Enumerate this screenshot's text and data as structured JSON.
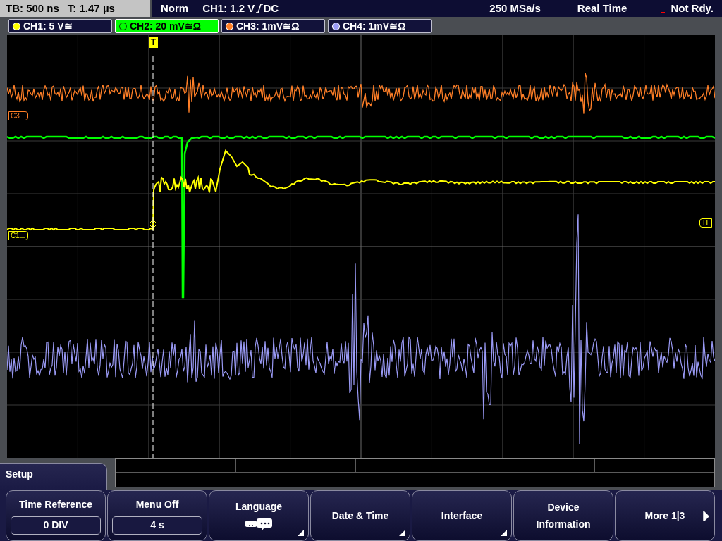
{
  "status_bar": {
    "timebase": "TB: 500 ns",
    "trigger_time": "T: 1.47 µs",
    "trigger_mode": "Norm",
    "trigger_level": "CH1: 1.2 V",
    "trigger_coupling": "DC",
    "sample_rate": "250 MSa/s",
    "acquisition": "Real Time",
    "status": "Not Rdy."
  },
  "channels": [
    {
      "label": "CH1: 5 V≅",
      "color": "#ffff00",
      "selected": false
    },
    {
      "label": "CH2: 20 mV≅Ω",
      "color": "#00ff00",
      "selected": true
    },
    {
      "label": "CH3: 1mV≅Ω",
      "color": "#ff7f27",
      "selected": false
    },
    {
      "label": "CH4: 1mV≅Ω",
      "color": "#9a9af5",
      "selected": false
    }
  ],
  "plot": {
    "trigger_marker": "T",
    "markers": [
      {
        "label": "C3⊥",
        "color": "#ff7f27",
        "kind": "channel"
      },
      {
        "label": "C1⊥",
        "color": "#ffff00",
        "kind": "channel"
      },
      {
        "label": "TL",
        "color": "#ffff00",
        "kind": "trigger_level"
      }
    ]
  },
  "menu": {
    "title": "Setup",
    "buttons": [
      {
        "kind": "value",
        "label": "Time Reference",
        "value": "0 DIV",
        "submenu": false
      },
      {
        "kind": "value",
        "label": "Menu Off",
        "value": "4 s",
        "submenu": false
      },
      {
        "kind": "icon",
        "label": "Language",
        "submenu": true
      },
      {
        "kind": "plain",
        "label": "Date & Time",
        "submenu": true
      },
      {
        "kind": "plain",
        "label": "Interface",
        "submenu": true
      },
      {
        "kind": "plain",
        "label": "Device Information",
        "submenu": false
      },
      {
        "kind": "next",
        "label": "More 1|3",
        "submenu": false
      }
    ]
  }
}
